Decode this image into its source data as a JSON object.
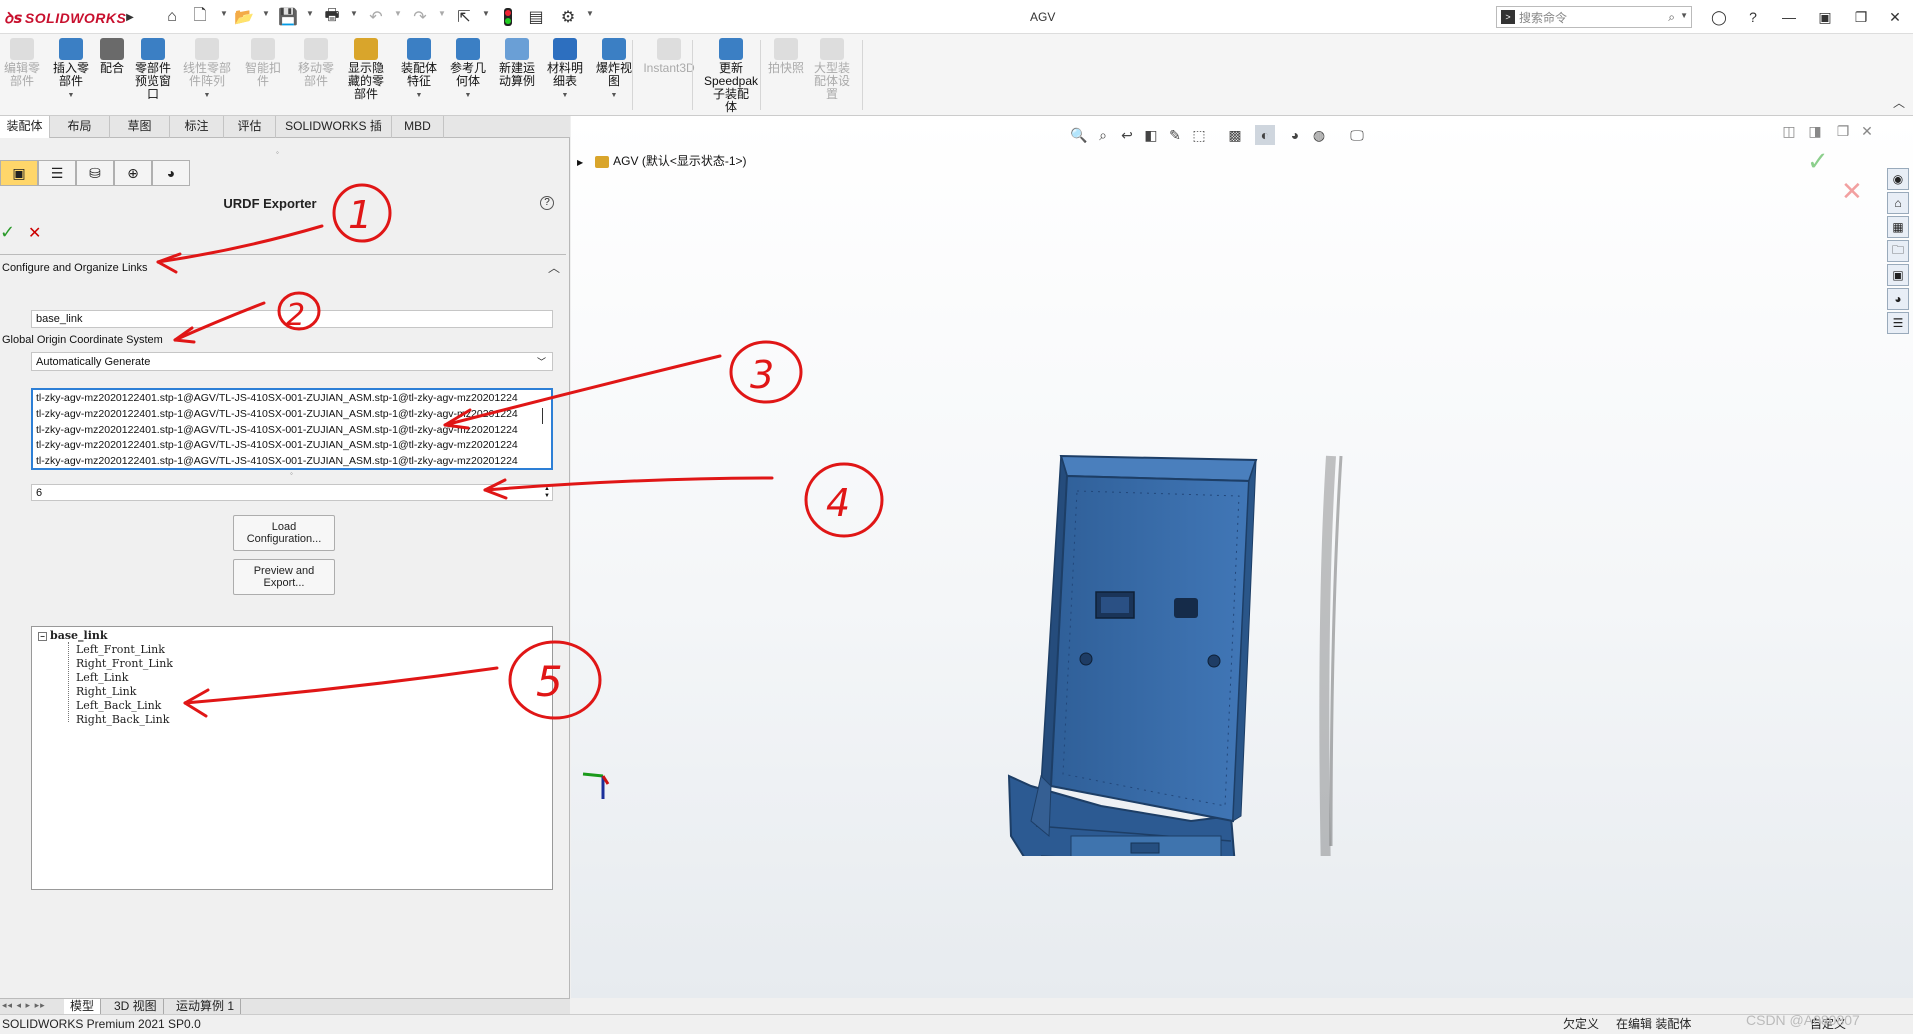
{
  "app": {
    "logo": "SOLIDWORKS",
    "title": "AGV",
    "search_placeholder": "搜索命令"
  },
  "ribbon": [
    {
      "label": "编辑零\n部件",
      "enabled": false
    },
    {
      "label": "插入零\n部件",
      "enabled": true
    },
    {
      "label": "配合",
      "enabled": true
    },
    {
      "label": "零部件\n预览窗\n口",
      "enabled": true
    },
    {
      "label": "线性零部\n件阵列",
      "enabled": false
    },
    {
      "label": "智能扣\n件",
      "enabled": false
    },
    {
      "label": "移动零\n部件",
      "enabled": false
    },
    {
      "label": "显示隐\n藏的零\n部件",
      "enabled": true
    },
    {
      "label": "装配体\n特征",
      "enabled": true
    },
    {
      "label": "参考几\n何体",
      "enabled": true
    },
    {
      "label": "新建运\n动算例",
      "enabled": true
    },
    {
      "label": "材料明\n细表",
      "enabled": true
    },
    {
      "label": "爆炸视\n图",
      "enabled": true
    },
    {
      "label": "Instant3D",
      "enabled": false
    },
    {
      "label": "更新\nSpeedpak\n子装配\n体",
      "enabled": true
    },
    {
      "label": "拍快照",
      "enabled": false
    },
    {
      "label": "大型装\n配体设\n置",
      "enabled": false
    }
  ],
  "tabs": [
    "装配体",
    "布局",
    "草图",
    "标注",
    "评估",
    "SOLIDWORKS 插件",
    "MBD"
  ],
  "panel": {
    "title": "URDF Exporter",
    "section_title": "Configure and Organize Links",
    "link_name": "base_link",
    "coord_label": "Global Origin Coordinate System",
    "coord_value": "Automatically Generate",
    "components": [
      "tl-zky-agv-mz2020122401.stp-1@AGV/TL-JS-410SX-001-ZUJIAN_ASM.stp-1@tl-zky-agv-mz20201224",
      "tl-zky-agv-mz2020122401.stp-1@AGV/TL-JS-410SX-001-ZUJIAN_ASM.stp-1@tl-zky-agv-mz20201224",
      "tl-zky-agv-mz2020122401.stp-1@AGV/TL-JS-410SX-001-ZUJIAN_ASM.stp-1@tl-zky-agv-mz20201224",
      "tl-zky-agv-mz2020122401.stp-1@AGV/TL-JS-410SX-001-ZUJIAN_ASM.stp-1@tl-zky-agv-mz20201224",
      "tl-zky-agv-mz2020122401.stp-1@AGV/TL-JS-410SX-001-ZUJIAN_ASM.stp-1@tl-zky-agv-mz20201224"
    ],
    "child_count": "6",
    "load_button": "Load\nConfiguration...",
    "preview_button": "Preview and\nExport...",
    "tree_root": "base_link",
    "tree_children": [
      "Left_Front_Link",
      "Right_Front_Link",
      "Left_Link",
      "Right_Link",
      "Left_Back_Link",
      "Right_Back_Link"
    ]
  },
  "viewport": {
    "tree_label": "AGV  (默认<显示状态-1>)",
    "model_color": "#3a6ea8"
  },
  "bottom_tabs": [
    "模型",
    "3D 视图",
    "运动算例 1"
  ],
  "status": {
    "product": "SOLIDWORKS Premium 2021 SP0.0",
    "undefined": "欠定义",
    "editing": "在编辑 装配体",
    "custom": "自定义",
    "watermark": "CSDN @A080807"
  },
  "annotations": [
    "1",
    "2",
    "3",
    "4",
    "5"
  ]
}
